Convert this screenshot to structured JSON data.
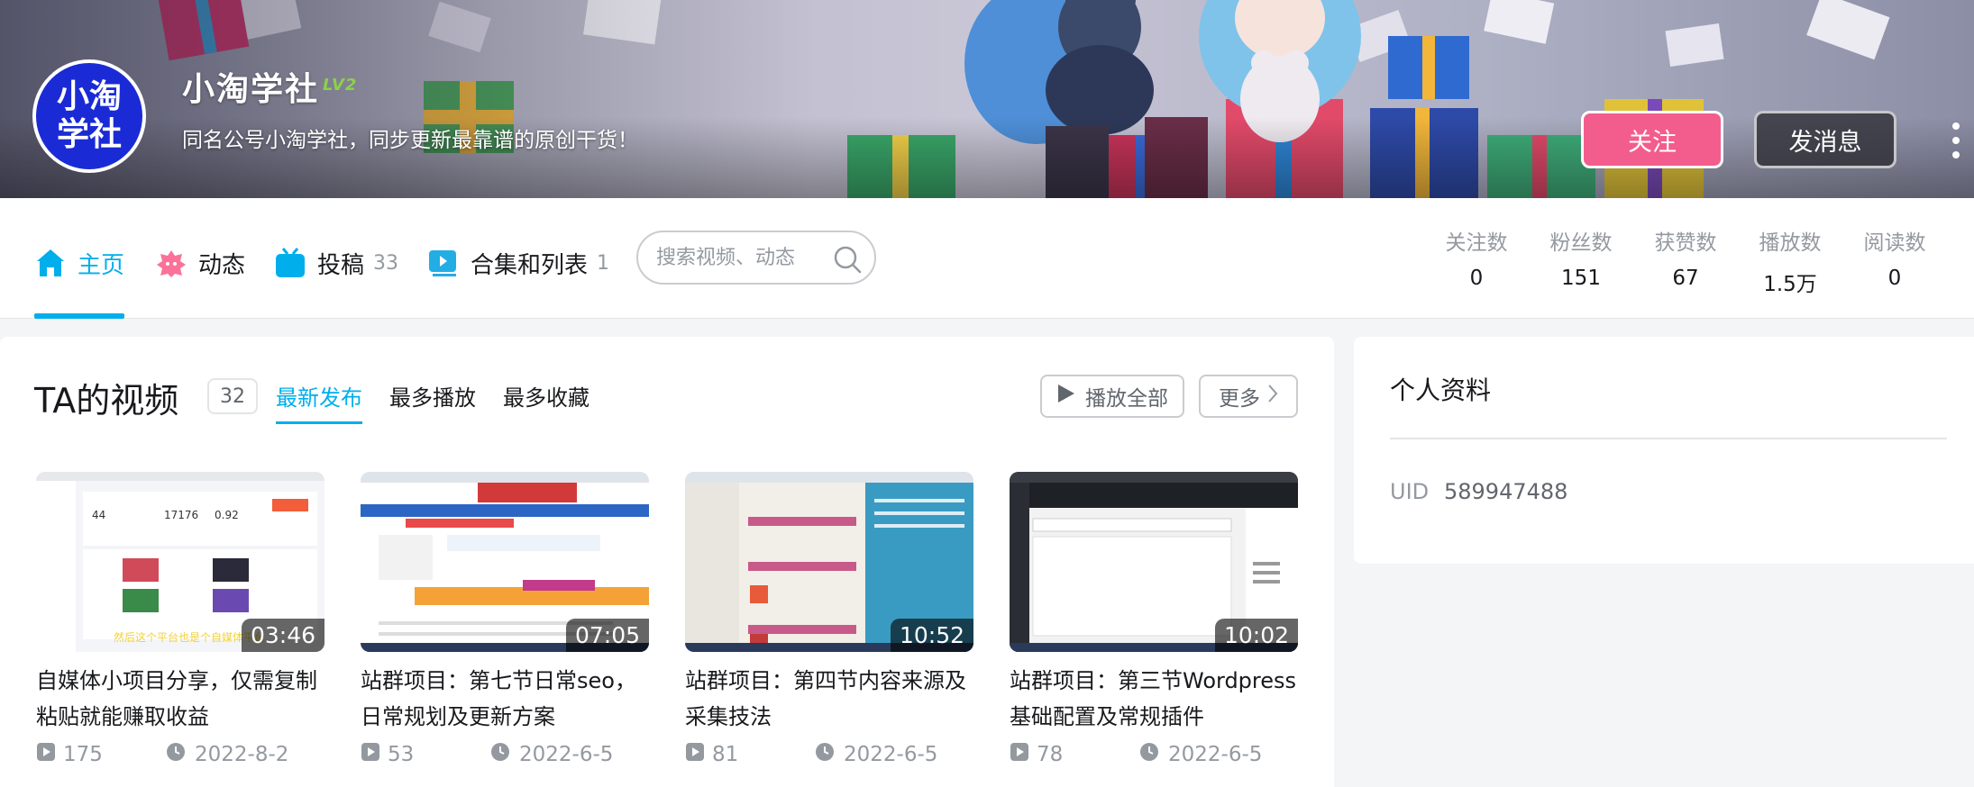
{
  "profile": {
    "avatar_text_line1": "小淘",
    "avatar_text_line2": "学社",
    "name": "小淘学社",
    "level": "LV2",
    "sign": "同名公号小淘学社，同步更新最靠谱的原创干货！",
    "follow_label": "关注",
    "message_label": "发消息"
  },
  "nav": {
    "tabs": [
      {
        "label": "主页",
        "count": "",
        "icon": "home-icon"
      },
      {
        "label": "动态",
        "count": "",
        "icon": "dynamic-icon"
      },
      {
        "label": "投稿",
        "count": "33",
        "icon": "upload-tv-icon"
      },
      {
        "label": "合集和列表",
        "count": "1",
        "icon": "collection-icon"
      }
    ],
    "search_placeholder": "搜索视频、动态",
    "stats": [
      {
        "label": "关注数",
        "value": "0"
      },
      {
        "label": "粉丝数",
        "value": "151"
      },
      {
        "label": "获赞数",
        "value": "67"
      },
      {
        "label": "播放数",
        "value": "1.5万"
      },
      {
        "label": "阅读数",
        "value": "0"
      }
    ]
  },
  "videos_section": {
    "title": "TA的视频",
    "count": "32",
    "sort_tabs": [
      "最新发布",
      "最多播放",
      "最多收藏"
    ],
    "play_all_label": "播放全部",
    "more_label": "更多",
    "items": [
      {
        "duration": "03:46",
        "title": "自媒体小项目分享，仅需复制粘贴就能赚取收益",
        "views": "175",
        "date": "2022-8-2",
        "thumb_caption": "然后这个平台也是个自媒体平台"
      },
      {
        "duration": "07:05",
        "title": "站群项目：第七节日常seo，日常规划及更新方案",
        "views": "53",
        "date": "2022-6-5"
      },
      {
        "duration": "10:52",
        "title": "站群项目：第四节内容来源及采集技法",
        "views": "81",
        "date": "2022-6-5"
      },
      {
        "duration": "10:02",
        "title": "站群项目：第三节Wordpress基础配置及常规插件",
        "views": "78",
        "date": "2022-6-5"
      }
    ]
  },
  "side": {
    "title": "个人资料",
    "uid_label": "UID",
    "uid_value": "589947488"
  },
  "colors": {
    "accent": "#00aeec",
    "follow_pink": "#f25d8e",
    "avatar_blue": "#1a2bd6"
  }
}
